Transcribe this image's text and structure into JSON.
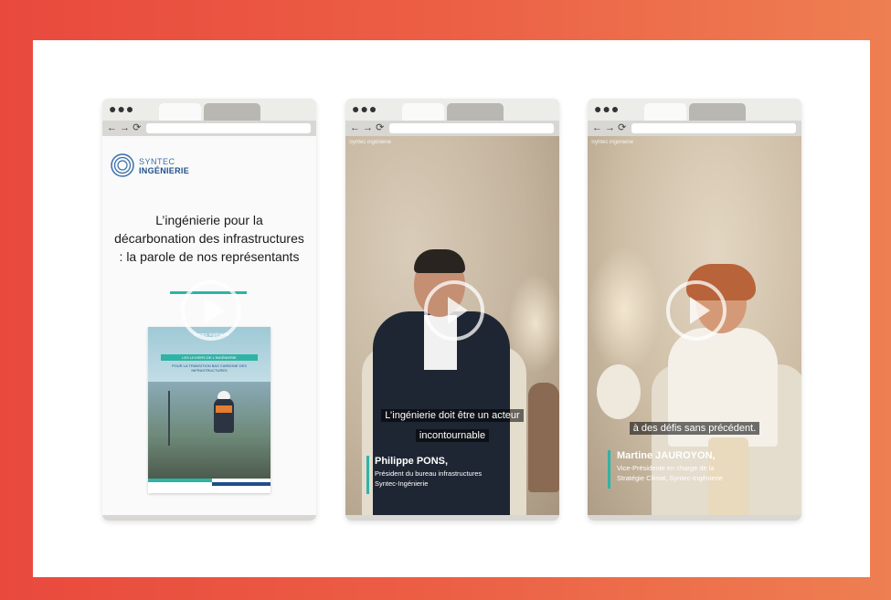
{
  "panels": [
    {
      "headline": "L’ingénierie pour la décarbonation des infrastructures : la parole de nos représentants",
      "logo": {
        "line1": "SYNTEC",
        "line2": "INGÉNIERIE"
      },
      "cover": {
        "logo": "Syntec ingénierie",
        "title": "LES LEVIERS DE L'INGÉNIERIE",
        "subtitle": "POUR LA TRANSITION BAS CARBONE DES INFRASTRUCTURES"
      }
    },
    {
      "watermark": "Syntec ingénierie",
      "caption_line1": "L’ingénierie doit être un acteur",
      "caption_line2": "incontournable",
      "speaker_name": "Philippe PONS,",
      "speaker_role_line1": "Président du bureau infrastructures",
      "speaker_role_line2": "Syntec-Ingénierie"
    },
    {
      "watermark": "Syntec ingénierie",
      "caption_line1": "à des défis sans précédent.",
      "speaker_name": "Martine JAUROYON,",
      "speaker_role_line1": "Vice-Présidente en charge de la",
      "speaker_role_line2": "Stratégie Climat, Syntec-Ingénierie"
    }
  ],
  "colors": {
    "frame_gradient_start": "#e9493d",
    "frame_gradient_end": "#ee7f52",
    "accent_teal": "#2fb3a5",
    "brand_blue": "#1f4f8a"
  },
  "icons": {
    "window_dots": "●●●",
    "nav": "← → ⟳"
  }
}
